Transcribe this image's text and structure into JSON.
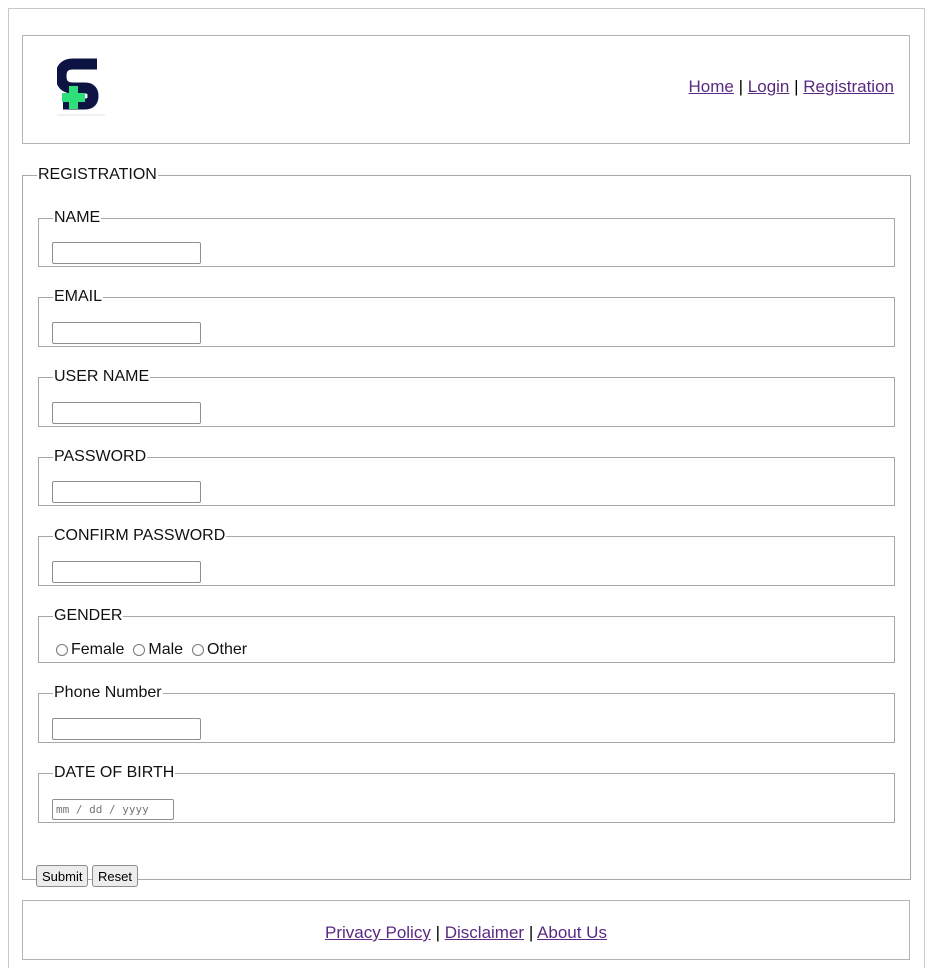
{
  "nav": {
    "home": "Home",
    "login": "Login",
    "registration": "Registration",
    "separator": "|"
  },
  "logo": {
    "letter": "S",
    "icon": "medical-cross-logo",
    "colors": {
      "letter": "#0d1443",
      "cross": "#2ee07a"
    }
  },
  "form": {
    "legend": "REGISTRATION",
    "fields": {
      "name": {
        "label": "NAME",
        "value": ""
      },
      "email": {
        "label": "EMAIL",
        "value": ""
      },
      "username": {
        "label": "USER NAME",
        "value": ""
      },
      "password": {
        "label": "PASSWORD",
        "value": ""
      },
      "confirm_password": {
        "label": "CONFIRM PASSWORD",
        "value": ""
      },
      "gender": {
        "label": "GENDER",
        "options": [
          "Female",
          "Male",
          "Other"
        ]
      },
      "phone": {
        "label": "Phone Number",
        "value": ""
      },
      "dob": {
        "label": "DATE OF BIRTH",
        "placeholder": "mm / dd / yyyy"
      }
    },
    "submit_label": "Submit",
    "reset_label": "Reset"
  },
  "footer": {
    "privacy": "Privacy Policy",
    "disclaimer": "Disclaimer",
    "about": "About Us",
    "separator": "|"
  },
  "colors": {
    "link": "#5a2a82",
    "border": "#a8a8a8"
  }
}
